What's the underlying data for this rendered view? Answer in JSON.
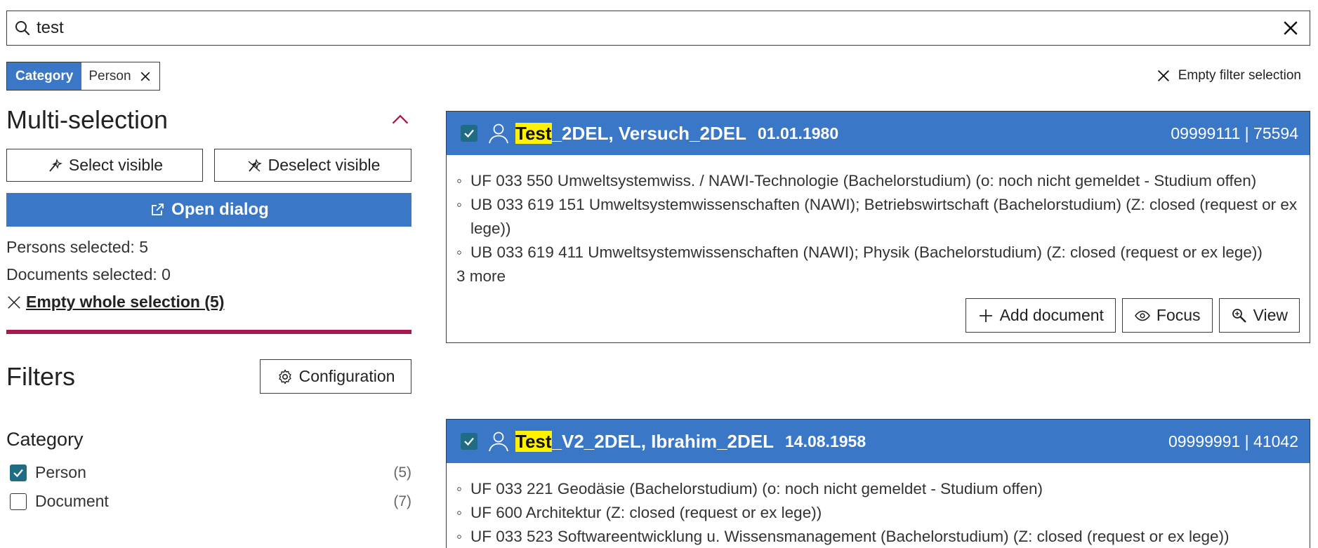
{
  "search": {
    "value": "test"
  },
  "chip": {
    "key": "Category",
    "value": "Person"
  },
  "empty_filter_label": "Empty filter selection",
  "multi": {
    "title": "Multi-selection",
    "select_visible": "Select visible",
    "deselect_visible": "Deselect visible",
    "open_dialog": "Open dialog",
    "persons_selected": "Persons selected: 5",
    "documents_selected": "Documents selected: 0",
    "empty_selection": " Empty whole selection (5)"
  },
  "filters": {
    "title": "Filters",
    "configuration": "Configuration",
    "category_title": "Category",
    "options": [
      {
        "label": "Person",
        "count": "(5)",
        "checked": true
      },
      {
        "label": "Document",
        "count": "(7)",
        "checked": false
      }
    ]
  },
  "colors": {
    "accent": "#3a77c6",
    "divider": "#a8184f",
    "checkbox": "#1f6c84",
    "highlight": "#fff200"
  },
  "results": [
    {
      "name_highlight": "Test",
      "name_rest": "_2DEL, Versuch_2DEL",
      "dob": "01.01.1980",
      "ids": "09999111  |  75594",
      "items": [
        "UF 033 550 Umweltsystemwiss. / NAWI-Technologie (Bachelorstudium) (o: noch nicht gemeldet - Studium offen)",
        "UB 033 619 151 Umweltsystemwissenschaften (NAWI); Betriebswirtschaft (Bachelorstudium) (Z: closed (request or ex lege))",
        "UB 033 619 411 Umweltsystemwissenschaften (NAWI); Physik (Bachelorstudium) (Z: closed (request or ex lege))"
      ],
      "more": "3 more",
      "add_document": "Add document",
      "focus": "Focus",
      "view": "View"
    },
    {
      "name_highlight": "Test",
      "name_rest": "_V2_2DEL, Ibrahim_2DEL",
      "dob": "14.08.1958",
      "ids": "09999991  |  41042",
      "items": [
        "UF 033 221 Geodäsie (Bachelorstudium) (o: noch nicht gemeldet - Studium offen)",
        "UF 600 Architektur (Z: closed (request or ex lege))",
        "UF 033 523 Softwareentwicklung u. Wissensmanagement (Bachelorstudium) (Z: closed (request or ex lege))"
      ]
    }
  ]
}
